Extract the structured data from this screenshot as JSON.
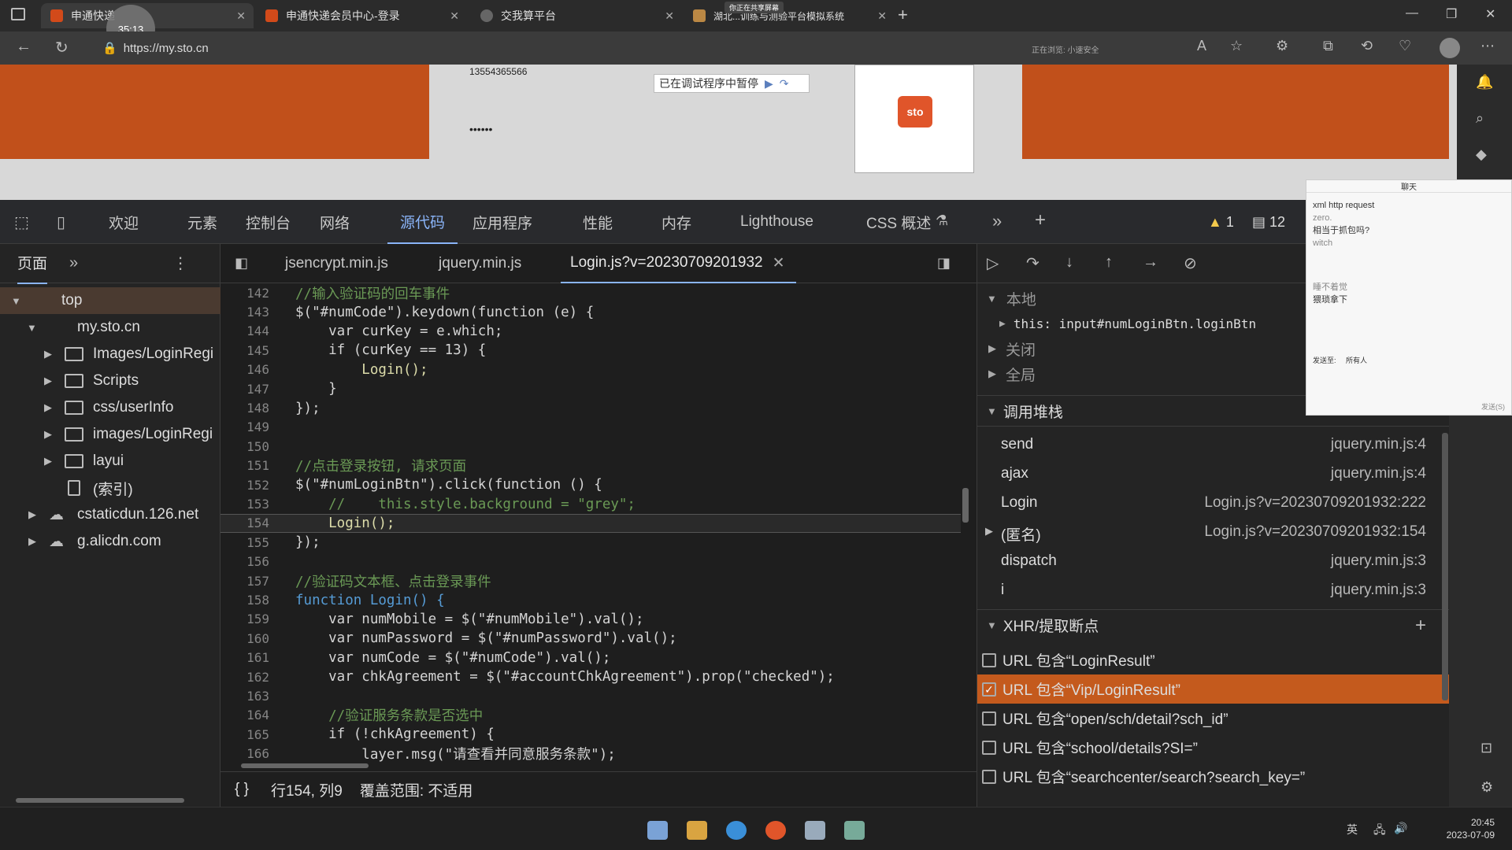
{
  "browser": {
    "tabs": [
      {
        "title": "申通快递",
        "active": true
      },
      {
        "title": "申通快递会员中心-登录",
        "active": false
      },
      {
        "title": "交我算平台",
        "active": false
      },
      {
        "title": "湖北...训练与测验平台模拟系统",
        "active": false
      }
    ],
    "new_tab": "+",
    "url": "https://my.sto.cn",
    "sharing_banner": "你正在共享屏幕",
    "recording_time": "35:13",
    "addr_extra": "正在浏览: 小速安全"
  },
  "page": {
    "phone": "13554365566",
    "password_mask": "••••••",
    "debugger_paused": "已在调试程序中暂停",
    "qr_logo": "sto"
  },
  "devtools": {
    "tabs": [
      "欢迎",
      "元素",
      "控制台",
      "网络",
      "源代码",
      "应用程序",
      "性能",
      "内存",
      "Lighthouse",
      "CSS 概述"
    ],
    "active_tab": "源代码",
    "warnings": "1",
    "messages": "12",
    "navigator": {
      "tab_label": "页面",
      "items": [
        {
          "label": "top",
          "level": 0
        },
        {
          "label": "my.sto.cn",
          "level": 1
        },
        {
          "label": "Images/LoginRegi",
          "level": 2
        },
        {
          "label": "Scripts",
          "level": 2
        },
        {
          "label": "css/userInfo",
          "level": 2
        },
        {
          "label": "images/LoginRegi",
          "level": 2
        },
        {
          "label": "layui",
          "level": 2
        },
        {
          "label": "(索引)",
          "level": 2
        },
        {
          "label": "cstaticdun.126.net",
          "level": 1
        },
        {
          "label": "g.alicdn.com",
          "level": 1
        }
      ]
    },
    "file_tabs": [
      "jsencrypt.min.js",
      "jquery.min.js",
      "Login.js?v=20230709201932"
    ],
    "active_file": "Login.js?v=20230709201932",
    "code_lines": [
      {
        "n": "142",
        "t": "//输入验证码的回车事件"
      },
      {
        "n": "143",
        "t": "$(\"#numCode\").keydown(function (e) {"
      },
      {
        "n": "144",
        "t": "    var curKey = e.which;"
      },
      {
        "n": "145",
        "t": "    if (curKey == 13) {"
      },
      {
        "n": "146",
        "t": "        Login();"
      },
      {
        "n": "147",
        "t": "    }"
      },
      {
        "n": "148",
        "t": "});"
      },
      {
        "n": "149",
        "t": ""
      },
      {
        "n": "150",
        "t": ""
      },
      {
        "n": "151",
        "t": "//点击登录按钮, 请求页面"
      },
      {
        "n": "152",
        "t": "$(\"#numLoginBtn\").click(function () {"
      },
      {
        "n": "153",
        "t": "    //    this.style.background = \"grey\";"
      },
      {
        "n": "154",
        "t": "    Login();"
      },
      {
        "n": "155",
        "t": "});"
      },
      {
        "n": "156",
        "t": ""
      },
      {
        "n": "157",
        "t": "//验证码文本框、点击登录事件"
      },
      {
        "n": "158",
        "t": "function Login() {"
      },
      {
        "n": "159",
        "t": "    var numMobile = $(\"#numMobile\").val();"
      },
      {
        "n": "160",
        "t": "    var numPassword = $(\"#numPassword\").val();"
      },
      {
        "n": "161",
        "t": "    var numCode = $(\"#numCode\").val();"
      },
      {
        "n": "162",
        "t": "    var chkAgreement = $(\"#accountChkAgreement\").prop(\"checked\");"
      },
      {
        "n": "163",
        "t": ""
      },
      {
        "n": "164",
        "t": "    //验证服务条款是否选中"
      },
      {
        "n": "165",
        "t": "    if (!chkAgreement) {"
      },
      {
        "n": "166",
        "t": "        layer.msg(\"请查看并同意服务条款\");"
      }
    ],
    "status": {
      "braces": "{ }",
      "position": "行154, 列9",
      "coverage": "覆盖范围: 不适用"
    },
    "scope": {
      "local_label": "本地",
      "this_text": "this: input#numLoginBtn.loginBtn",
      "closure_label": "关闭",
      "global_label": "全局"
    },
    "callstack": {
      "label": "调用堆栈",
      "frames": [
        {
          "fn": "send",
          "loc": "jquery.min.js:4"
        },
        {
          "fn": "ajax",
          "loc": "jquery.min.js:4"
        },
        {
          "fn": "Login",
          "loc": "Login.js?v=20230709201932:222"
        },
        {
          "fn": "(匿名)",
          "loc": "Login.js?v=20230709201932:154"
        },
        {
          "fn": "dispatch",
          "loc": "jquery.min.js:3"
        },
        {
          "fn": "i",
          "loc": "jquery.min.js:3"
        }
      ]
    },
    "xhr": {
      "label": "XHR/提取断点",
      "items": [
        {
          "text": "URL 包含“LoginResult”",
          "checked": false
        },
        {
          "text": "URL 包含“Vip/LoginResult”",
          "checked": true
        },
        {
          "text": "URL 包含“open/sch/detail?sch_id”",
          "checked": false
        },
        {
          "text": "URL 包含“school/details?SI=”",
          "checked": false
        },
        {
          "text": "URL 包含“searchcenter/search?search_key=”",
          "checked": false
        }
      ]
    }
  },
  "chat": {
    "title": "聊天",
    "lines": [
      "xml http request",
      "zero.",
      "相当于抓包吗?",
      "witch",
      "睡不着觉",
      "猥琐拿下"
    ],
    "send_to": "发送至:",
    "send_target": "所有人",
    "send_btn": "发送(S)"
  },
  "taskbar": {
    "ime": "英",
    "time": "20:45",
    "date": "2023-07-09"
  },
  "colors": {
    "accent": "#8ab4f8",
    "selected_xhr": "#c45a1d",
    "brand_orange": "#c1501b"
  }
}
